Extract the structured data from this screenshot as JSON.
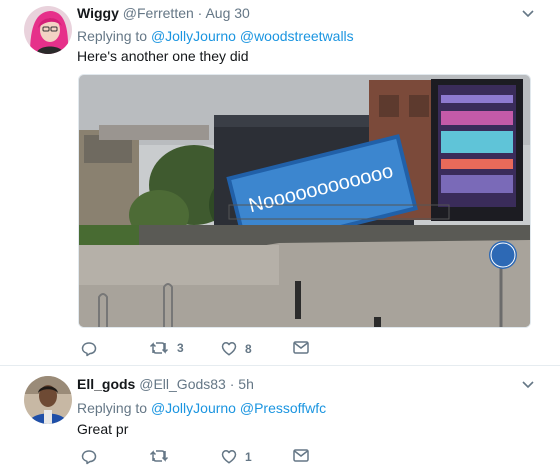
{
  "tweets": [
    {
      "name": "Wiggy",
      "handle": "@Ferretten",
      "separator": "·",
      "time": "Aug 30",
      "replying_prefix": "Replying to",
      "replying_to": [
        "@JollyJourno",
        "@woodstreetwalls"
      ],
      "text": "Here's another one they did",
      "photo_billboard_text": "Noooooooooooo",
      "actions": {
        "reply": "",
        "retweet": "3",
        "like": "8"
      }
    },
    {
      "name": "Ell_gods",
      "handle": "@Ell_Gods83",
      "separator": "·",
      "time": "5h",
      "replying_prefix": "Replying to",
      "replying_to": [
        "@JollyJourno",
        "@Pressoffwfc"
      ],
      "text": "Great pr",
      "actions": {
        "reply": "",
        "retweet": "",
        "like": "1"
      }
    }
  ],
  "icons": [
    "chevron-down-icon",
    "reply-icon",
    "retweet-icon",
    "like-icon",
    "direct-message-icon"
  ],
  "colors": {
    "link": "#1b95e0",
    "muted": "#657786",
    "text": "#14171a",
    "divider": "#e6ecf0"
  }
}
